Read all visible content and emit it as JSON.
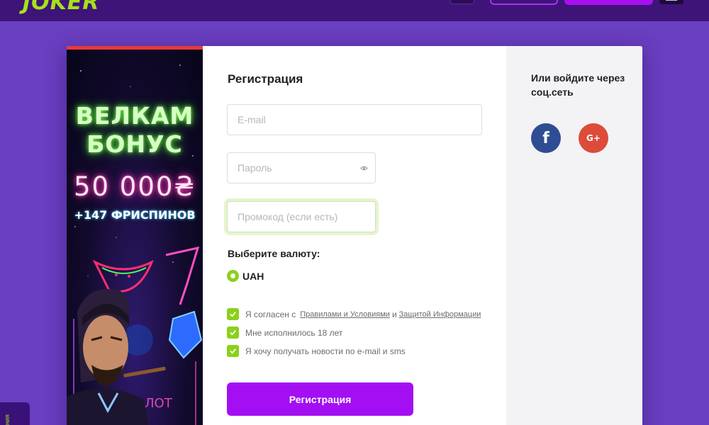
{
  "header": {
    "logo_text": "JOKER"
  },
  "side_widget": {
    "label": "ния"
  },
  "banner": {
    "line1": "ВЕЛКАМ",
    "line2": "БОНУС",
    "amount": "50 000₴",
    "spins": "+147 ФРИСПИНОВ"
  },
  "form": {
    "title": "Регистрация",
    "email_placeholder": "E-mail",
    "password_placeholder": "Пароль",
    "promo_placeholder": "Промокод (если есть)",
    "currency_label": "Выберите валюту:",
    "currency_option": "UAH",
    "agree_prefix": "Я согласен с",
    "agree_rules_link": "Правилами и Условиями",
    "agree_and": "и",
    "agree_privacy_link": "Защитой Информации",
    "age_label": "Мне исполнилось 18 лет",
    "news_label": "Я хочу получать новости по e-mail и sms",
    "submit_label": "Регистрация"
  },
  "social": {
    "title": "Или войдите через соц.сеть",
    "facebook_glyph": "f",
    "google_glyph": "G+"
  },
  "colors": {
    "page_bg": "#6a3fc0",
    "header_bg": "#3e1478",
    "accent_green": "#8ad11a",
    "accent_purple": "#a30ff2",
    "banner_top_border": "#e83a3a",
    "facebook": "#2f4d92",
    "google": "#dd4b39"
  }
}
